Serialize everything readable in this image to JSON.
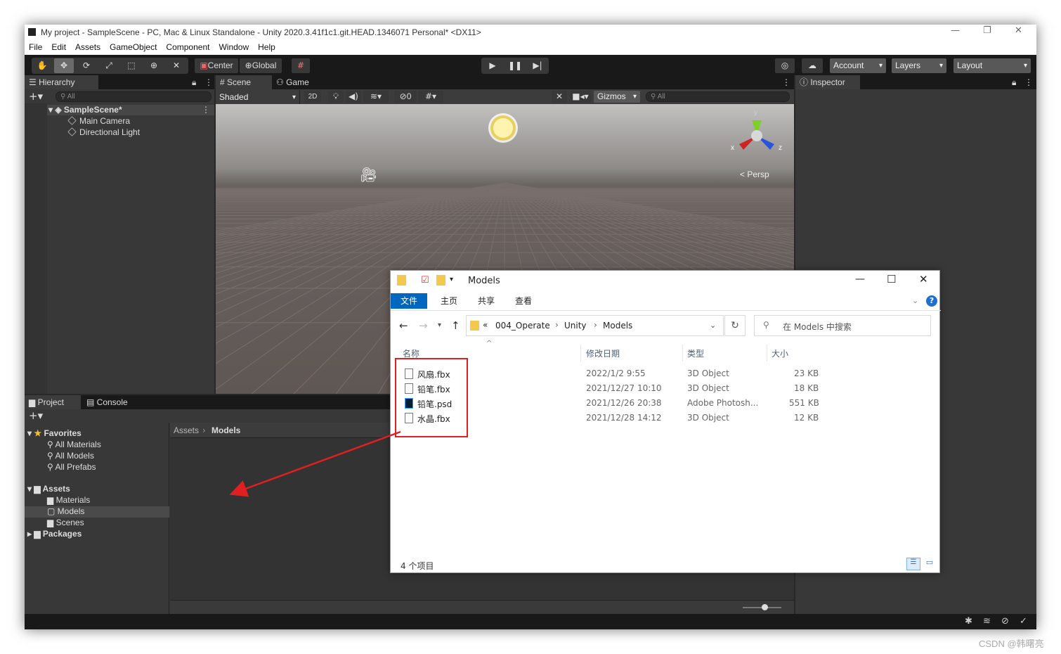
{
  "unity": {
    "title": "My project - SampleScene - PC, Mac & Linux Standalone - Unity 2020.3.41f1c1.git.HEAD.1346071 Personal* <DX11>",
    "menu": [
      "File",
      "Edit",
      "Assets",
      "GameObject",
      "Component",
      "Window",
      "Help"
    ],
    "toolbar": {
      "center": "Center",
      "global": "Global",
      "account": "Account",
      "layers": "Layers",
      "layout": "Layout"
    },
    "hierarchy": {
      "tab": "Hierarchy",
      "search_placeholder": "All",
      "scene": "SampleScene*",
      "items": [
        "Main Camera",
        "Directional Light"
      ]
    },
    "scene_view": {
      "tabs": [
        "Scene",
        "Game"
      ],
      "shading": "Shaded",
      "mode_2d": "2D",
      "hidden_count": "0",
      "gizmos": "Gizmos",
      "search_placeholder": "All",
      "axis_x": "x",
      "axis_y": "y",
      "axis_z": "z",
      "persp": "Persp"
    },
    "inspector": {
      "tab": "Inspector"
    },
    "project": {
      "tabs": [
        "Project",
        "Console"
      ],
      "favorites_label": "Favorites",
      "favorites": [
        "All Materials",
        "All Models",
        "All Prefabs"
      ],
      "assets_label": "Assets",
      "assets": [
        "Materials",
        "Models",
        "Scenes"
      ],
      "packages_label": "Packages",
      "breadcrumb": [
        "Assets",
        "Models"
      ]
    }
  },
  "explorer": {
    "title": "Models",
    "ribbon": [
      "文件",
      "主页",
      "共享",
      "查看"
    ],
    "path": [
      "004_Operate",
      "Unity",
      "Models"
    ],
    "path_prefix": "«",
    "search_placeholder": "在 Models 中搜索",
    "columns": [
      "名称",
      "修改日期",
      "类型",
      "大小"
    ],
    "files": [
      {
        "name": "风扇.fbx",
        "date": "2022/1/2 9:55",
        "type": "3D Object",
        "size": "23 KB"
      },
      {
        "name": "铅笔.fbx",
        "date": "2021/12/27 10:10",
        "type": "3D Object",
        "size": "18 KB"
      },
      {
        "name": "铅笔.psd",
        "date": "2021/12/26 20:38",
        "type": "Adobe Photosh...",
        "size": "551 KB"
      },
      {
        "name": "水晶.fbx",
        "date": "2021/12/28 14:12",
        "type": "3D Object",
        "size": "12 KB"
      }
    ],
    "status": "4 个项目"
  },
  "watermark": "CSDN @韩曙亮",
  "colors": {
    "accent": "#0067c0",
    "annotation": "#e02020",
    "unity_bg": "#383838"
  }
}
